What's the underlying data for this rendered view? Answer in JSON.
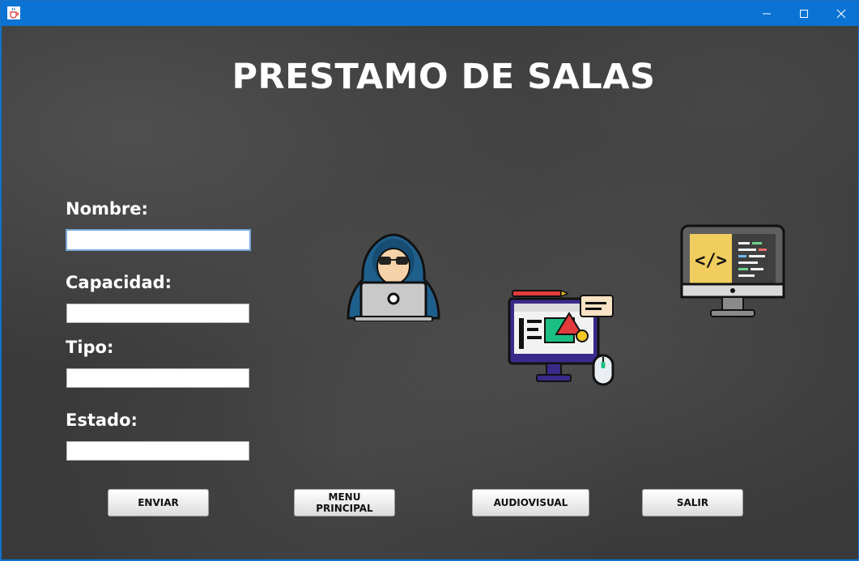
{
  "window": {
    "icon": "java-cup-icon",
    "controls": [
      "minimize-icon",
      "maximize-icon",
      "close-icon"
    ]
  },
  "page": {
    "title": "PRESTAMO DE SALAS"
  },
  "form": {
    "nombre": {
      "label": "Nombre:",
      "value": ""
    },
    "capacidad": {
      "label": "Capacidad:",
      "value": ""
    },
    "tipo": {
      "label": "Tipo:",
      "value": ""
    },
    "estado": {
      "label": "Estado:",
      "value": ""
    }
  },
  "buttons": {
    "enviar": "ENVIAR",
    "menu_principal": "MENU PRINCIPAL",
    "audiovisual": "AUDIOVISUAL",
    "salir": "SALIR"
  },
  "illustrations": [
    "hacker-laptop-icon",
    "design-monitor-icon",
    "code-monitor-icon"
  ],
  "colors": {
    "titlebar": "#0a73d3",
    "background": "#3a3a3a",
    "text": "#ffffff"
  }
}
